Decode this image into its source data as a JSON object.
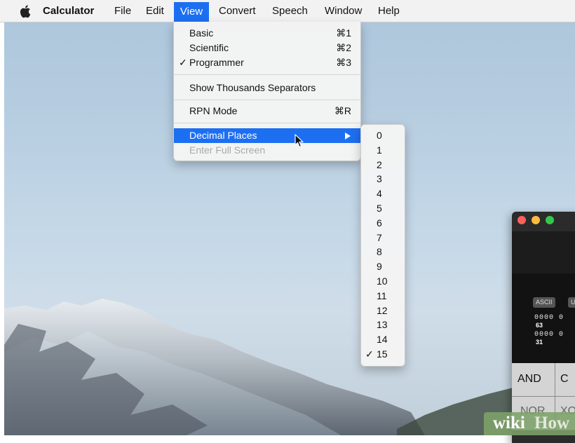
{
  "menubar": {
    "apple_icon": "apple-logo",
    "app_name": "Calculator",
    "items": [
      "File",
      "Edit",
      "View",
      "Convert",
      "Speech",
      "Window",
      "Help"
    ],
    "active_item": "View"
  },
  "view_menu": {
    "basic": {
      "label": "Basic",
      "shortcut": "⌘1"
    },
    "scientific": {
      "label": "Scientific",
      "shortcut": "⌘2"
    },
    "programmer": {
      "label": "Programmer",
      "shortcut": "⌘3",
      "check": "✓"
    },
    "thousands": {
      "label": "Show Thousands Separators"
    },
    "rpn": {
      "label": "RPN Mode",
      "shortcut": "⌘R"
    },
    "decimal": {
      "label": "Decimal Places",
      "highlighted": true
    },
    "fullscreen": {
      "label": "Enter Full Screen",
      "disabled": true
    }
  },
  "decimal_submenu": {
    "items": [
      "0",
      "1",
      "2",
      "3",
      "4",
      "5",
      "6",
      "7",
      "8",
      "9",
      "10",
      "11",
      "12",
      "13",
      "14",
      "15"
    ],
    "checked": "15",
    "check_mark": "✓"
  },
  "calculator": {
    "mode_ascii": "ASCII",
    "mode_unicode": "U",
    "bit_row_1": "0000 0",
    "bit_num_1": "63",
    "bit_row_2": "0000 0",
    "bit_num_2": "31",
    "keys": {
      "and": "AND",
      "or": "C",
      "nor": "NOR",
      "xor": "XO"
    }
  },
  "watermark": {
    "wiki": "wiki",
    "how": "How"
  },
  "colors": {
    "highlight": "#1d6ff2",
    "menu_bg": "#f4f4f4",
    "disabled_text": "#a9a9a9"
  }
}
